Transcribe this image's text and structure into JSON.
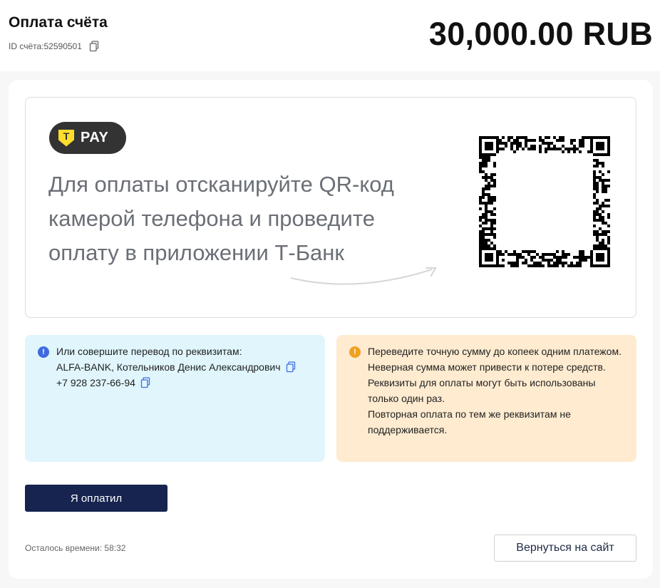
{
  "header": {
    "title": "Оплата счёта",
    "invoice_label": "ID счёта:",
    "invoice_id": "52590501",
    "amount": "30,000.00 RUB",
    "copy_icon": "copy-icon"
  },
  "qr_panel": {
    "logo_letter": "Т",
    "logo_text": "PAY",
    "instruction": "Для оплаты отсканируйте QR-код камерой телефона и проведите оплату в приложении Т-Банк",
    "arrow_icon": "arrow-right-curved-icon"
  },
  "details": {
    "icon": "info-icon",
    "line1": "Или совершите перевод по реквизитам:",
    "line2": "ALFA-BANK, Котельников Денис Александрович",
    "line3": "+7 928 237-66-94"
  },
  "warning": {
    "icon": "warning-icon",
    "text1": "Переведите точную сумму до копеек одним платежом.",
    "text2": "Неверная сумма может привести к потере средств.",
    "text3": "Реквизиты для оплаты могут быть использованы только один раз.",
    "text4": "Повторная оплата по тем же реквизитам не поддерживается."
  },
  "actions": {
    "paid_label": "Я оплатил",
    "back_label": "Вернуться на сайт",
    "timer_label": "Осталось времени:",
    "timer_value": "58:32"
  },
  "colors": {
    "primary": "#17244f",
    "info_bg": "#e0f5fc",
    "warning_bg": "#feebd0",
    "info_icon": "#3f6be0",
    "warning_icon": "#f0a020",
    "tpay_yellow": "#ffdd2d"
  }
}
